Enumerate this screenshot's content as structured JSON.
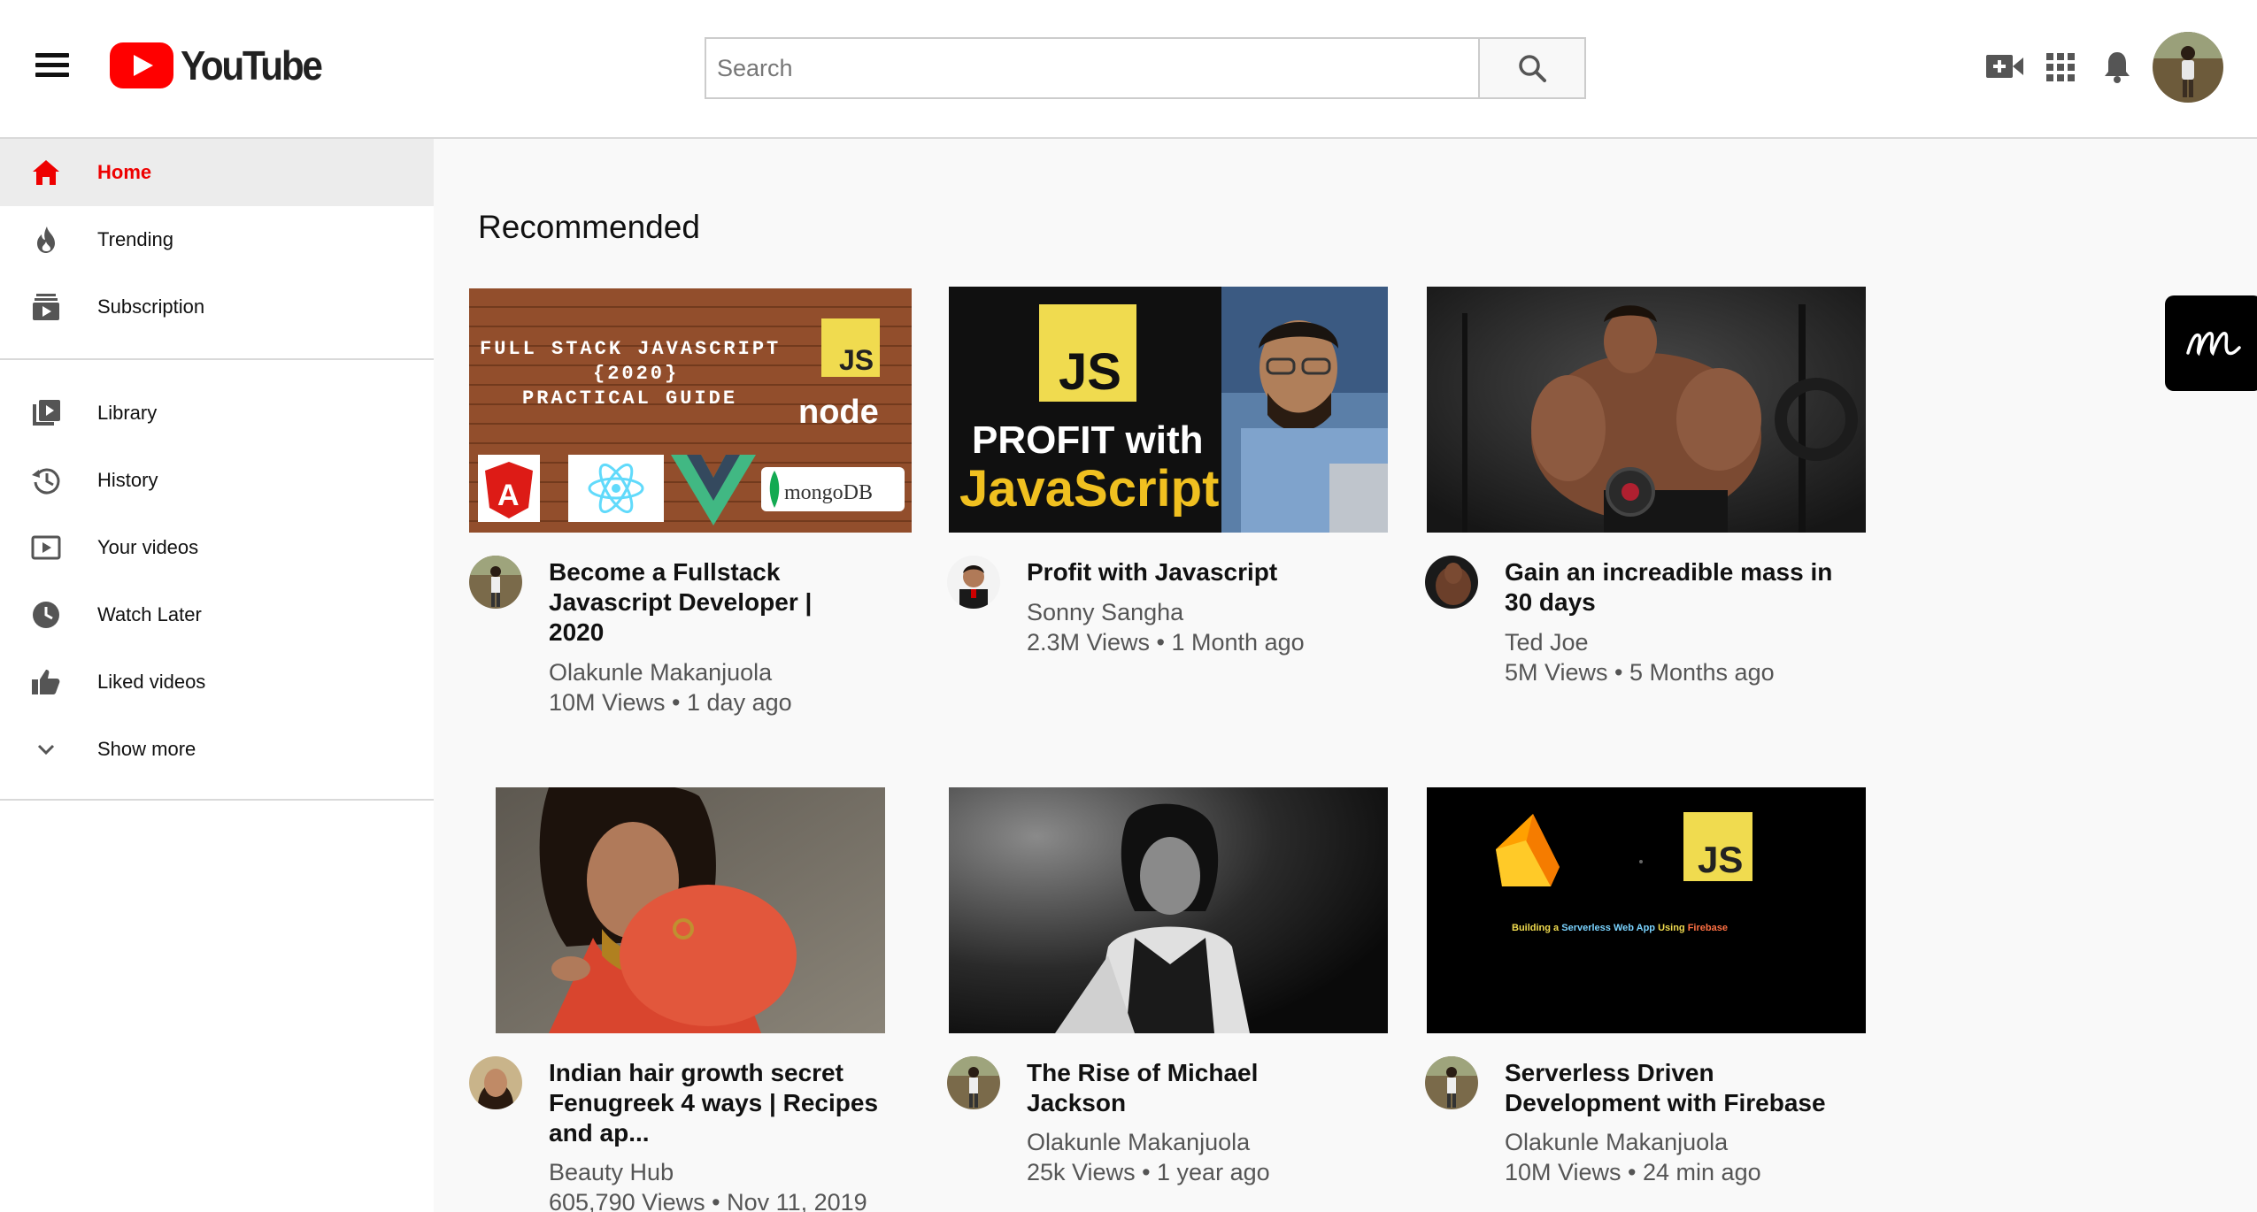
{
  "header": {
    "logo_text": "YouTube",
    "search_placeholder": "Search"
  },
  "sidebar": {
    "items": [
      {
        "label": "Home",
        "icon": "home-icon",
        "active": true
      },
      {
        "label": "Trending",
        "icon": "fire-icon"
      },
      {
        "label": "Subscription",
        "icon": "subscriptions-icon"
      },
      {
        "label": "Library",
        "icon": "library-icon"
      },
      {
        "label": "History",
        "icon": "history-icon"
      },
      {
        "label": "Your videos",
        "icon": "your-videos-icon"
      },
      {
        "label": "Watch Later",
        "icon": "clock-icon"
      },
      {
        "label": "Liked videos",
        "icon": "thumbs-up-icon"
      },
      {
        "label": "Show more",
        "icon": "chevron-down-icon"
      }
    ]
  },
  "main": {
    "section_title": "Recommended",
    "videos": [
      {
        "title_lines": [
          "Become a Fullstack",
          "Javascript Developer |",
          "2020"
        ],
        "channel": "Olakunle Makanjuola",
        "meta": "10M Views • 1 day ago",
        "thumb_text": {
          "line1": "FULL STACK JAVASCRIPT",
          "line2": "{2020}",
          "line3": "PRACTICAL GUIDE",
          "js": "JS",
          "node": "node",
          "mongo": "mongoDB"
        }
      },
      {
        "title_lines": [
          "Profit with Javascript"
        ],
        "channel": "Sonny Sangha",
        "meta": "2.3M Views • 1 Month ago",
        "thumb_text": {
          "js": "JS",
          "line1": "PROFIT with",
          "line2": "JavaScript"
        }
      },
      {
        "title_lines": [
          "Gain an increadible mass in",
          "30 days"
        ],
        "channel": "Ted Joe",
        "meta": "5M Views • 5 Months ago"
      },
      {
        "title_lines": [
          "Indian hair growth secret",
          "Fenugreek 4 ways | Recipes",
          "and ap..."
        ],
        "channel": "Beauty Hub",
        "meta": "605,790 Views • Nov 11, 2019"
      },
      {
        "title_lines": [
          "The Rise of Michael",
          "Jackson"
        ],
        "channel": "Olakunle Makanjuola",
        "meta": "25k Views • 1 year ago"
      },
      {
        "title_lines": [
          "Serverless Driven",
          "Development with Firebase"
        ],
        "channel": "Olakunle Makanjuola",
        "meta": "10M Views • 24 min ago",
        "thumb_text": {
          "js": "JS",
          "caption_a": "Building a ",
          "caption_b": "Serverless Web App",
          "caption_c": " Using ",
          "caption_d": "Firebase"
        }
      }
    ]
  },
  "colors": {
    "brand_red": "#ff0000",
    "active_red": "#e00000",
    "js_yellow": "#f0db4f"
  }
}
